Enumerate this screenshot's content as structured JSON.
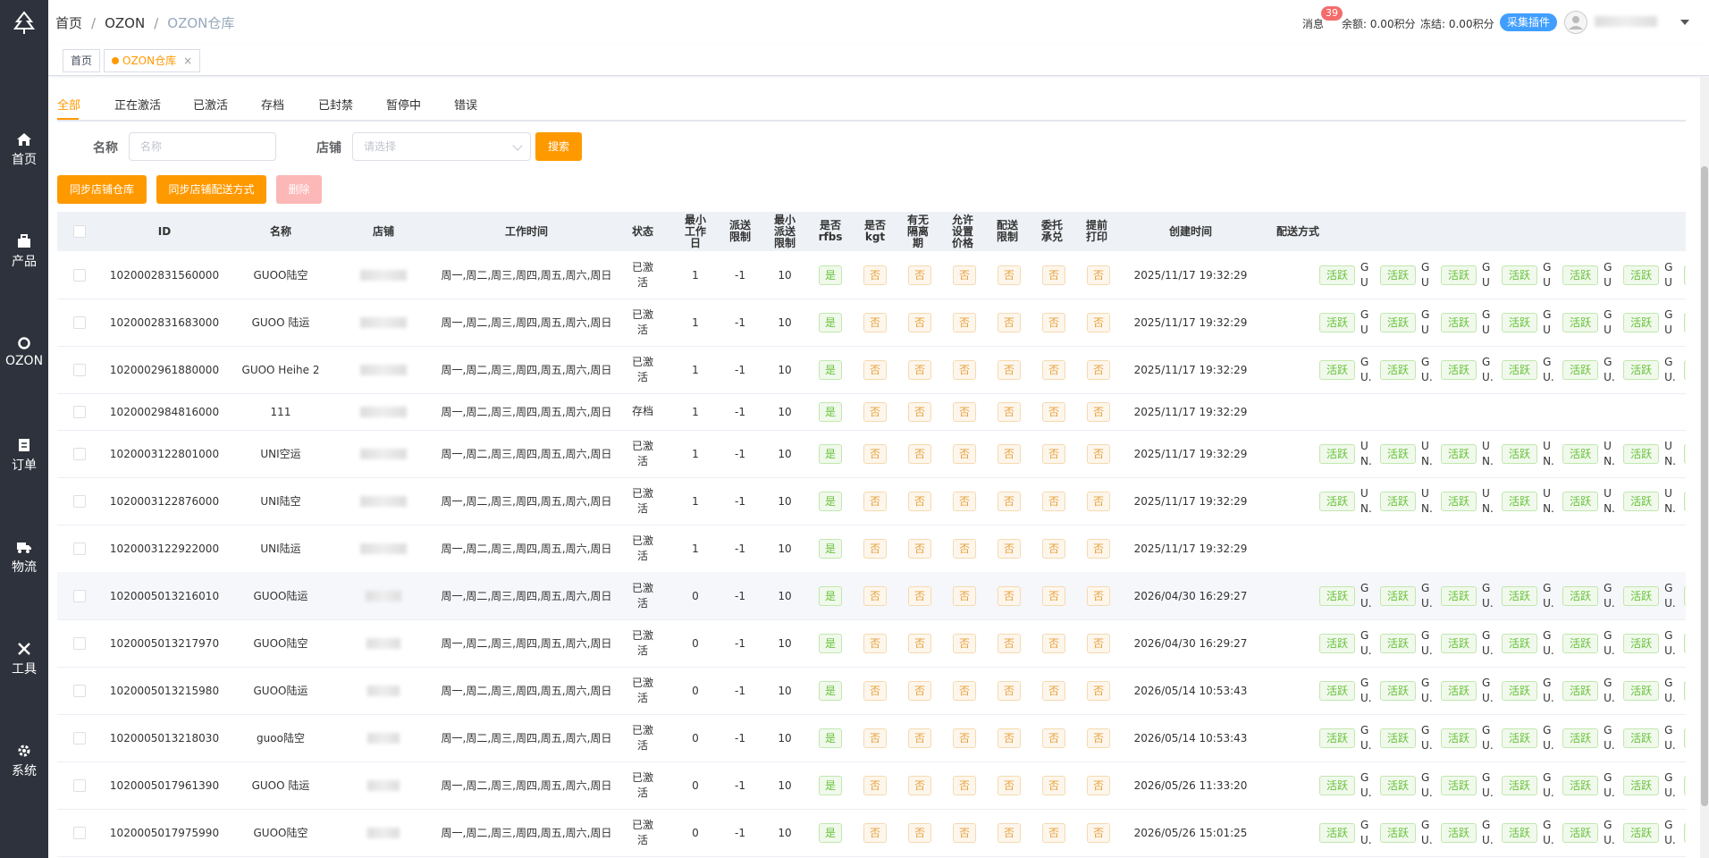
{
  "sidebar": {
    "items": [
      {
        "label": "首页",
        "icon": "home-icon"
      },
      {
        "label": "产品",
        "icon": "product-icon"
      },
      {
        "label": "OZON",
        "icon": "ozon-icon"
      },
      {
        "label": "订单",
        "icon": "order-icon"
      },
      {
        "label": "物流",
        "icon": "truck-icon"
      },
      {
        "label": "工具",
        "icon": "tools-icon"
      },
      {
        "label": "系统",
        "icon": "gear-icon"
      }
    ]
  },
  "header": {
    "breadcrumb": [
      "首页",
      "OZON",
      "OZON仓库"
    ],
    "message_label": "消息",
    "message_count": "39",
    "balance": "余额: 0.00积分",
    "frozen": "冻结: 0.00积分",
    "plugin_button": "采集插件"
  },
  "tags": {
    "home": "首页",
    "current": "OZON仓库",
    "close": "×"
  },
  "tabs": [
    "全部",
    "正在激活",
    "已激活",
    "存档",
    "已封禁",
    "暂停中",
    "错误"
  ],
  "filters": {
    "name_label": "名称",
    "name_placeholder": "名称",
    "shop_label": "店铺",
    "shop_placeholder": "请选择",
    "search_button": "搜索"
  },
  "actions": {
    "sync_warehouse": "同步店铺仓库",
    "sync_delivery": "同步店铺配送方式",
    "delete": "删除"
  },
  "table": {
    "headers": {
      "id": "ID",
      "name": "名称",
      "shop": "店铺",
      "worktime": "工作时间",
      "status": "状态",
      "min_work_day": "最小工作日",
      "delivery_limit": "派送限制",
      "min_delivery_limit": "最小派送限制",
      "rfbs": "是否rfbs",
      "kgt": "是否kgt",
      "quarantine": "有无隔离期",
      "price": "允许设置价格",
      "ship_limit": "配送限制",
      "consign": "委托承兑",
      "early_print": "提前打印",
      "created": "创建时间",
      "delivery": "配送方式"
    },
    "yes": "是",
    "no": "否",
    "active": "活跃",
    "rows": [
      {
        "id": "1020002831560000",
        "name": "GUOO陆空",
        "worktime": "周一,周二,周三,周四,周五,周六,周日",
        "status": "已激活",
        "min_day": "1",
        "limit": "-1",
        "min_limit": "10",
        "created": "2025/11/17 19:32:29",
        "ship_prefix": "GUO...",
        "ship_count": 7
      },
      {
        "id": "1020002831683000",
        "name": "GUOO 陆运",
        "worktime": "周一,周二,周三,周四,周五,周六,周日",
        "status": "已激活",
        "min_day": "1",
        "limit": "-1",
        "min_limit": "10",
        "created": "2025/11/17 19:32:29",
        "ship_prefix": "GUO...",
        "ship_count": 7
      },
      {
        "id": "1020002961880000",
        "name": "GUOO Heihe 2",
        "worktime": "周一,周二,周三,周四,周五,周六,周日",
        "status": "已激活",
        "min_day": "1",
        "limit": "-1",
        "min_limit": "10",
        "created": "2025/11/17 19:32:29",
        "ship_prefix": "GU.",
        "ship_count": 8
      },
      {
        "id": "1020002984816000",
        "name": "111",
        "worktime": "周一,周二,周三,周四,周五,周六,周日",
        "status": "存档",
        "min_day": "1",
        "limit": "-1",
        "min_limit": "10",
        "created": "2025/11/17 19:32:29",
        "ship_prefix": "",
        "ship_count": 0
      },
      {
        "id": "1020003122801000",
        "name": "UNI空运",
        "worktime": "周一,周二,周三,周四,周五,周六,周日",
        "status": "已激活",
        "min_day": "1",
        "limit": "-1",
        "min_limit": "10",
        "created": "2025/11/17 19:32:29",
        "ship_prefix": "UN.",
        "ship_count": 8
      },
      {
        "id": "1020003122876000",
        "name": "UNI陆空",
        "worktime": "周一,周二,周三,周四,周五,周六,周日",
        "status": "已激活",
        "min_day": "1",
        "limit": "-1",
        "min_limit": "10",
        "created": "2025/11/17 19:32:29",
        "ship_prefix": "UN.",
        "ship_count": 8
      },
      {
        "id": "1020003122922000",
        "name": "UNI陆运",
        "worktime": "周一,周二,周三,周四,周五,周六,周日",
        "status": "已激活",
        "min_day": "1",
        "limit": "-1",
        "min_limit": "10",
        "created": "2025/11/17 19:32:29",
        "ship_prefix": "",
        "ship_count": 0
      },
      {
        "id": "1020005013216010",
        "name": "GUOO陆运",
        "worktime": "周一,周二,周三,周四,周五,周六,周日",
        "status": "已激活",
        "min_day": "0",
        "limit": "-1",
        "min_limit": "10",
        "created": "2026/04/30 16:29:27",
        "ship_prefix": "GU.",
        "ship_count": 8
      },
      {
        "id": "1020005013217970",
        "name": "GUOO陆空",
        "worktime": "周一,周二,周三,周四,周五,周六,周日",
        "status": "已激活",
        "min_day": "0",
        "limit": "-1",
        "min_limit": "10",
        "created": "2026/04/30 16:29:27",
        "ship_prefix": "GU.",
        "ship_count": 8
      },
      {
        "id": "1020005013215980",
        "name": "GUOO陆运",
        "worktime": "周一,周二,周三,周四,周五,周六,周日",
        "status": "已激活",
        "min_day": "0",
        "limit": "-1",
        "min_limit": "10",
        "created": "2026/05/14 10:53:43",
        "ship_prefix": "GU.",
        "ship_count": 8
      },
      {
        "id": "1020005013218030",
        "name": "guoo陆空",
        "worktime": "周一,周二,周三,周四,周五,周六,周日",
        "status": "已激活",
        "min_day": "0",
        "limit": "-1",
        "min_limit": "10",
        "created": "2026/05/14 10:53:43",
        "ship_prefix": "GU.",
        "ship_count": 8
      },
      {
        "id": "1020005017961390",
        "name": "GUOO 陆运",
        "worktime": "周一,周二,周三,周四,周五,周六,周日",
        "status": "已激活",
        "min_day": "0",
        "limit": "-1",
        "min_limit": "10",
        "created": "2026/05/26 11:33:20",
        "ship_prefix": "GU.",
        "ship_count": 8
      },
      {
        "id": "1020005017975990",
        "name": "GUOO陆空",
        "worktime": "周一,周二,周三,周四,周五,周六,周日",
        "status": "已激活",
        "min_day": "0",
        "limit": "-1",
        "min_limit": "10",
        "created": "2026/05/26 15:01:25",
        "ship_prefix": "GU.",
        "ship_count": 8
      }
    ]
  },
  "colors": {
    "accent": "#ff9900",
    "sidebar": "#2e323c",
    "blue": "#409eff",
    "green": "#67c23a",
    "orange": "#e6a23c"
  }
}
